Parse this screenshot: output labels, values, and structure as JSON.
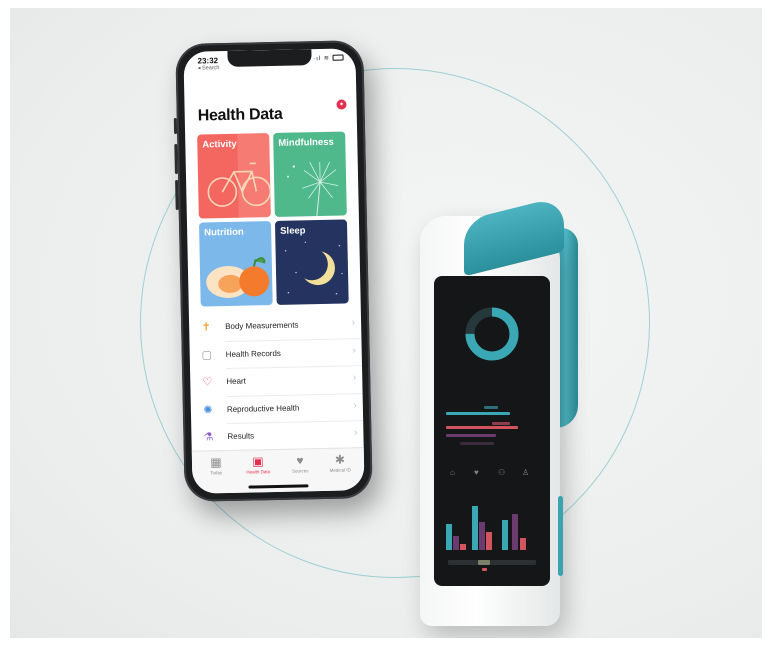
{
  "phone": {
    "status": {
      "time": "23:32",
      "back_label": "◂ Search",
      "signal": "·ıl",
      "wifi": "≋"
    },
    "title": "Health Data",
    "tiles": [
      {
        "label": "Activity",
        "color": "#f46660"
      },
      {
        "label": "Mindfulness",
        "color": "#4fb98c"
      },
      {
        "label": "Nutrition",
        "color": "#7db8ea"
      },
      {
        "label": "Sleep",
        "color": "#24335f"
      }
    ],
    "list": [
      {
        "label": "Body Measurements",
        "icon": "figure-icon",
        "glyph": "✝"
      },
      {
        "label": "Health Records",
        "icon": "clipboard-icon",
        "glyph": "▢"
      },
      {
        "label": "Heart",
        "icon": "heart-icon",
        "glyph": "♡"
      },
      {
        "label": "Reproductive Health",
        "icon": "flower-icon",
        "glyph": "✺"
      },
      {
        "label": "Results",
        "icon": "flask-icon",
        "glyph": "⚗"
      }
    ],
    "tabs": [
      {
        "label": "Today",
        "icon": "calendar-icon",
        "glyph": "▦",
        "active": false
      },
      {
        "label": "Health Data",
        "icon": "grid-icon",
        "glyph": "▣",
        "active": true
      },
      {
        "label": "Sources",
        "icon": "heart-shield-icon",
        "glyph": "♥",
        "active": false
      },
      {
        "label": "Medical ID",
        "icon": "asterisk-icon",
        "glyph": "✱",
        "active": false
      }
    ],
    "chevron": "›"
  },
  "device": {
    "accent": "#3aa7b4",
    "ring_fraction": 0.75,
    "icons": [
      {
        "name": "home-icon",
        "glyph": "⌂"
      },
      {
        "name": "heart-icon",
        "glyph": "♥"
      },
      {
        "name": "people-icon",
        "glyph": "⚇"
      },
      {
        "name": "person-icon",
        "glyph": "♙"
      }
    ]
  },
  "colors": {
    "accent_red": "#e2304f",
    "teal": "#3aa7b4",
    "purple": "#6b3a6e",
    "salmon": "#d2545e"
  }
}
